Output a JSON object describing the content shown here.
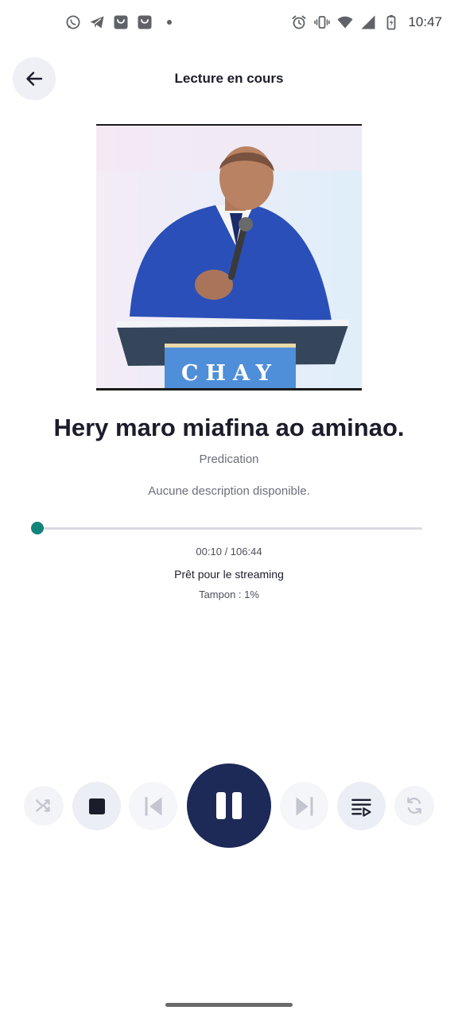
{
  "status_bar": {
    "time": "10:47",
    "left_icons": [
      "whatsapp-icon",
      "telegram-icon",
      "shop-icon",
      "shop-icon",
      "dot-icon"
    ],
    "right_icons": [
      "alarm-icon",
      "vibrate-icon",
      "wifi-icon",
      "signal-icon",
      "battery-charging-icon"
    ]
  },
  "header": {
    "title": "Lecture en cours",
    "back_icon": "arrow-left-icon"
  },
  "artwork": {
    "podium_text": "CHAY"
  },
  "track": {
    "title": "Hery maro miafina ao aminao.",
    "category": "Predication",
    "description": "Aucune description disponible."
  },
  "progress": {
    "fraction": 0.0016,
    "time_label": "00:10 / 106:44",
    "status": "Prêt pour le streaming",
    "buffer_label": "Tampon : 1%"
  },
  "controls": [
    {
      "name": "shuffle",
      "icon": "shuffle-icon",
      "state": "disabled"
    },
    {
      "name": "stop",
      "icon": "stop-icon"
    },
    {
      "name": "previous",
      "icon": "skip-previous-icon",
      "state": "disabled"
    },
    {
      "name": "pause",
      "icon": "pause-icon",
      "state": "playing"
    },
    {
      "name": "next",
      "icon": "skip-next-icon",
      "state": "disabled"
    },
    {
      "name": "queue",
      "icon": "queue-music-icon"
    },
    {
      "name": "repeat",
      "icon": "repeat-icon",
      "state": "disabled"
    }
  ],
  "colors": {
    "accent": "#12857a",
    "primary_button": "#1d2957",
    "text": "#1b1d2b",
    "muted_text": "#6b6f7b"
  }
}
